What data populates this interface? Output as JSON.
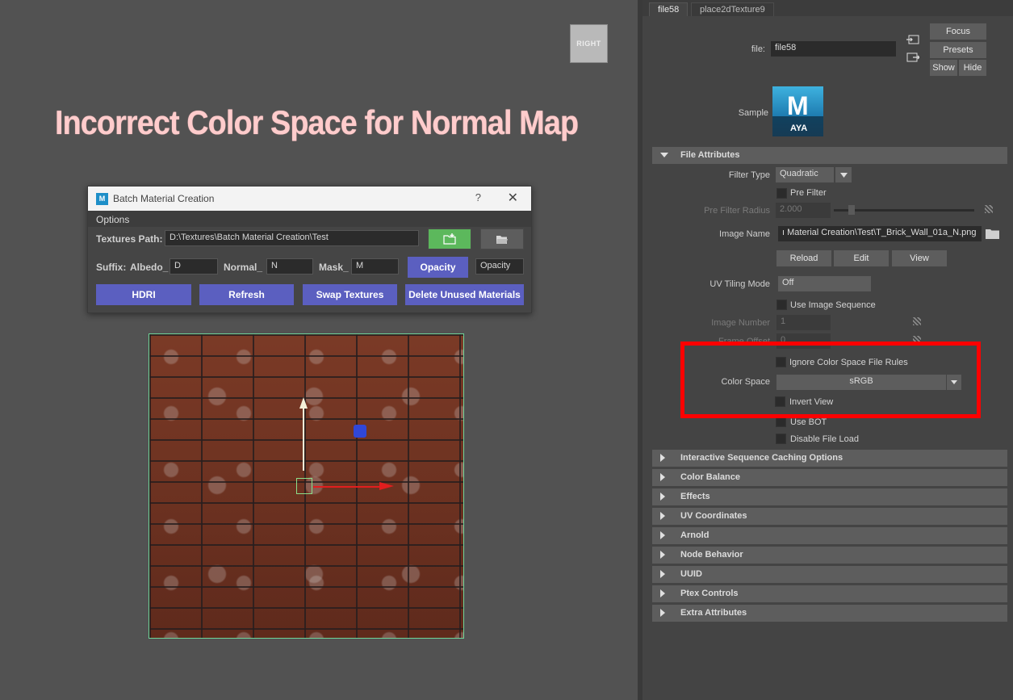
{
  "viewport": {
    "view_cube_label": "RIGHT",
    "headline": "Incorrect Color Space for Normal Map"
  },
  "batch_dialog": {
    "logo": "M",
    "title": "Batch Material Creation",
    "help": "?",
    "close": "✕",
    "menu_options": "Options",
    "textures_path_label": "Textures Path:",
    "textures_path_value": "D:\\Textures\\Batch Material Creation\\Test",
    "suffix_label": "Suffix:",
    "albedo_label": "Albedo_",
    "albedo_value": "D",
    "normal_label": "Normal_",
    "normal_value": "N",
    "mask_label": "Mask_",
    "mask_value": "M",
    "opacity_button": "Opacity",
    "opacity_value": "Opacity",
    "hdri_button": "HDRI",
    "refresh_button": "Refresh",
    "swap_button": "Swap Textures",
    "delete_button": "Delete Unused Materials",
    "new_folder_icon": "folder-plus-icon",
    "open_folder_icon": "folder-open-icon"
  },
  "attribute_editor": {
    "tabs": [
      "file58",
      "place2dTexture9"
    ],
    "file_label": "file:",
    "file_value": "file58",
    "focus_button": "Focus",
    "presets_button": "Presets",
    "show_button": "Show",
    "hide_button": "Hide",
    "sample_label": "Sample",
    "sample_logo_m": "M",
    "sample_logo_aya": "AYA",
    "file_attributes_section": "File Attributes",
    "filter_type_label": "Filter Type",
    "filter_type_value": "Quadratic",
    "pre_filter_label": "Pre Filter",
    "pre_filter_radius_label": "Pre Filter Radius",
    "pre_filter_radius_value": "2.000",
    "image_name_label": "Image Name",
    "image_name_value": "ı Material Creation\\Test\\T_Brick_Wall_01a_N.png",
    "reload_button": "Reload",
    "edit_button": "Edit",
    "view_button": "View",
    "uv_tiling_label": "UV Tiling Mode",
    "uv_tiling_value": "Off",
    "use_image_sequence_label": "Use Image Sequence",
    "image_number_label": "Image Number",
    "image_number_value": "1",
    "frame_offset_label": "Frame Offset",
    "frame_offset_value": "0",
    "ignore_cs_rules_label": "Ignore Color Space File Rules",
    "color_space_label": "Color Space",
    "color_space_value": "sRGB",
    "invert_view_label": "Invert View",
    "use_bot_label": "Use BOT",
    "disable_file_load_label": "Disable File Load",
    "sections": [
      "Interactive Sequence Caching Options",
      "Color Balance",
      "Effects",
      "UV Coordinates",
      "Arnold",
      "Node Behavior",
      "UUID",
      "Ptex Controls",
      "Extra Attributes"
    ],
    "highlight_color": "#ff0000"
  }
}
